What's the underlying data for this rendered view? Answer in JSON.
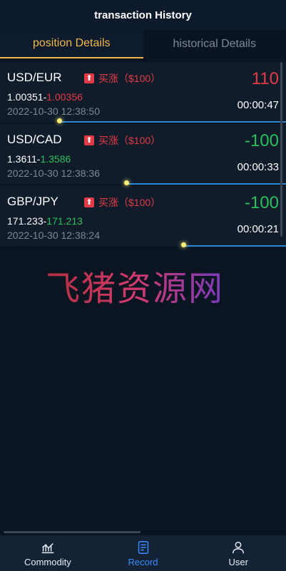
{
  "header": {
    "title": "transaction History"
  },
  "tabs": [
    {
      "label": "position Details",
      "active": true
    },
    {
      "label": "historical Details",
      "active": false
    }
  ],
  "positions": [
    {
      "pair": "USD/EUR",
      "direction_icon": "up-arrow-icon",
      "direction_label": "买涨（$100）",
      "open_price": "1.00351",
      "close_price": "1.00356",
      "close_color": "red",
      "time": "2022-10-30 12:38:50",
      "profit": "110",
      "profit_color": "red",
      "timer": "00:00:47"
    },
    {
      "pair": "USD/CAD",
      "direction_icon": "up-arrow-icon",
      "direction_label": "买涨（$100）",
      "open_price": "1.3611",
      "close_price": "1.3586",
      "close_color": "green",
      "time": "2022-10-30 12:38:36",
      "profit": "-100",
      "profit_color": "green",
      "timer": "00:00:33"
    },
    {
      "pair": "GBP/JPY",
      "direction_icon": "up-arrow-icon",
      "direction_label": "买涨（$100）",
      "open_price": "171.233",
      "close_price": "171.213",
      "close_color": "green",
      "time": "2022-10-30 12:38:24",
      "profit": "-100",
      "profit_color": "green",
      "timer": "00:00:21"
    }
  ],
  "watermark": "飞猪资源网",
  "bottom_nav": [
    {
      "label": "Commodity",
      "icon": "chart-icon",
      "active": false
    },
    {
      "label": "Record",
      "icon": "document-icon",
      "active": true
    },
    {
      "label": "User",
      "icon": "user-icon",
      "active": false
    }
  ],
  "colors": {
    "red": "#e23b46",
    "green": "#29c05a",
    "gold": "#f1b64d",
    "blue": "#3a8cff"
  }
}
